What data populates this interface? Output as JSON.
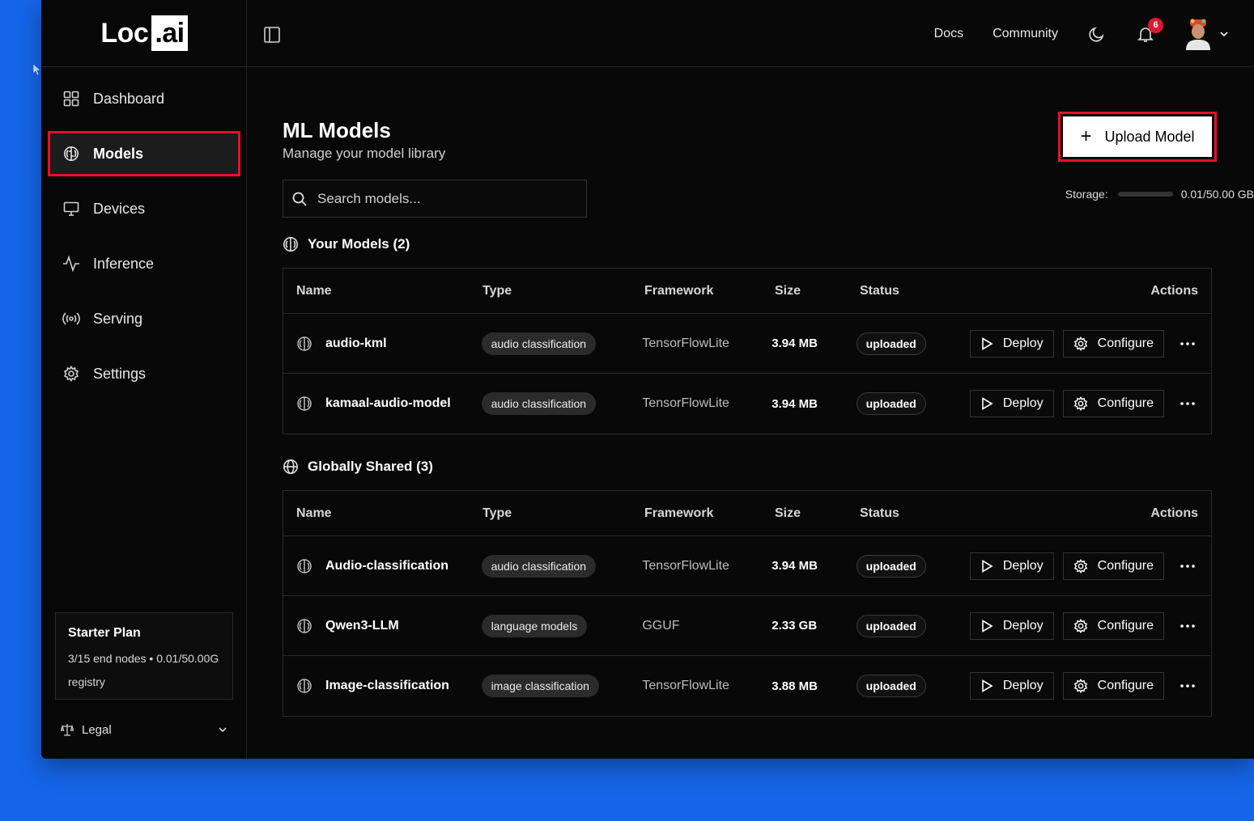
{
  "app": {
    "logo_text": "Loc",
    "logo_badge": ".ai"
  },
  "sidebar": {
    "items": [
      {
        "label": "Dashboard",
        "icon": "grid-icon"
      },
      {
        "label": "Models",
        "icon": "brain-icon",
        "active": true
      },
      {
        "label": "Devices",
        "icon": "monitor-icon"
      },
      {
        "label": "Inference",
        "icon": "activity-icon"
      },
      {
        "label": "Serving",
        "icon": "broadcast-icon"
      },
      {
        "label": "Settings",
        "icon": "gear-icon"
      }
    ],
    "plan": {
      "title": "Starter Plan",
      "line1": "3/15 end nodes • 0.01/50.00G",
      "line2": "registry"
    },
    "legal_label": "Legal"
  },
  "header": {
    "docs": "Docs",
    "community": "Community",
    "notification_count": "6"
  },
  "page": {
    "title": "ML Models",
    "subtitle": "Manage your model library",
    "upload_label": "Upload Model",
    "search_placeholder": "Search models...",
    "storage_label": "Storage:",
    "storage_value": "0.01/50.00 GB",
    "storage_fraction": 0.0002
  },
  "columns": {
    "name": "Name",
    "type": "Type",
    "framework": "Framework",
    "size": "Size",
    "status": "Status",
    "actions": "Actions"
  },
  "actions": {
    "deploy": "Deploy",
    "configure": "Configure"
  },
  "your_models": {
    "title": "Your Models (2)",
    "rows": [
      {
        "name": "audio-kml",
        "type": "audio classification",
        "framework": "TensorFlowLite",
        "size": "3.94 MB",
        "status": "uploaded"
      },
      {
        "name": "kamaal-audio-model",
        "type": "audio classification",
        "framework": "TensorFlowLite",
        "size": "3.94 MB",
        "status": "uploaded"
      }
    ]
  },
  "shared_models": {
    "title": "Globally Shared (3)",
    "rows": [
      {
        "name": "Audio-classification",
        "type": "audio classification",
        "framework": "TensorFlowLite",
        "size": "3.94 MB",
        "status": "uploaded"
      },
      {
        "name": "Qwen3-LLM",
        "type": "language models",
        "framework": "GGUF",
        "size": "2.33 GB",
        "status": "uploaded"
      },
      {
        "name": "Image-classification",
        "type": "image classification",
        "framework": "TensorFlowLite",
        "size": "3.88 MB",
        "status": "uploaded"
      }
    ]
  },
  "colors": {
    "accent_red": "#e3122b",
    "badge_red": "#d81b32",
    "desktop_blue": "#1565e8"
  }
}
